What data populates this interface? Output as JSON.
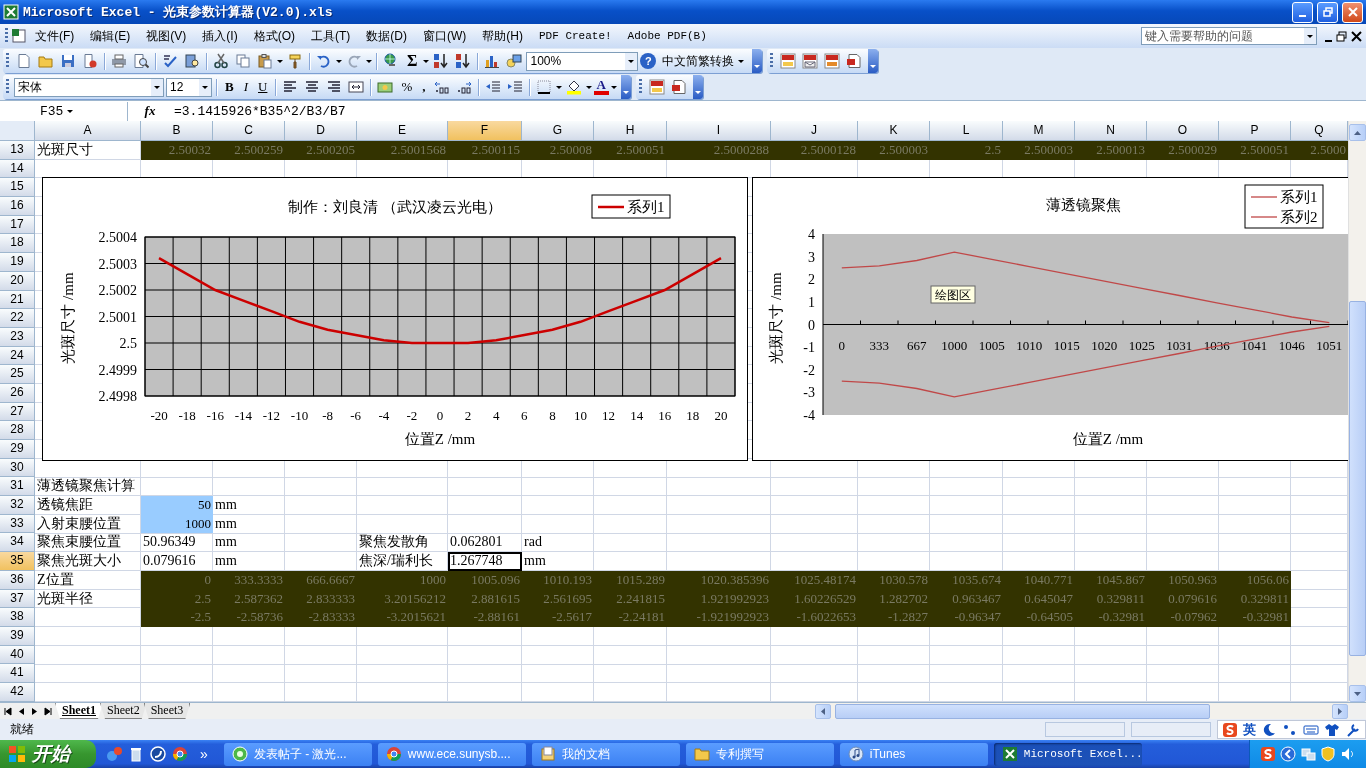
{
  "window": {
    "title": "Microsoft Excel - 光束参数计算器(V2.0).xls"
  },
  "menu": [
    {
      "label": "文件(F)"
    },
    {
      "label": "编辑(E)"
    },
    {
      "label": "视图(V)"
    },
    {
      "label": "插入(I)"
    },
    {
      "label": "格式(O)"
    },
    {
      "label": "工具(T)"
    },
    {
      "label": "数据(D)"
    },
    {
      "label": "窗口(W)"
    },
    {
      "label": "帮助(H)"
    },
    {
      "label": "PDF Create!"
    },
    {
      "label": "Adobe PDF(B)"
    }
  ],
  "help_box": {
    "placeholder": "键入需要帮助的问题"
  },
  "standard_toolbar": {
    "autosum": "Σ",
    "zoom": "100%",
    "help": "?",
    "convert": "中文简繁转换"
  },
  "formatting_toolbar": {
    "font": "宋体",
    "size": "12",
    "bold": "B",
    "italic": "I",
    "underline": "U",
    "percent": "%",
    "comma": ",",
    "font_color": "A"
  },
  "formula_bar": {
    "name_box": "F35",
    "fx": "fx",
    "formula": "=3.1415926*B35^2/B3/B7"
  },
  "sheet": {
    "columns": [
      {
        "label": "A",
        "selected": false
      },
      {
        "label": "B",
        "selected": false
      },
      {
        "label": "C",
        "selected": false
      },
      {
        "label": "D",
        "selected": false
      },
      {
        "label": "E",
        "selected": false
      },
      {
        "label": "F",
        "selected": true
      },
      {
        "label": "G",
        "selected": false
      },
      {
        "label": "H",
        "selected": false
      },
      {
        "label": "I",
        "selected": false
      },
      {
        "label": "J",
        "selected": false
      },
      {
        "label": "K",
        "selected": false
      },
      {
        "label": "L",
        "selected": false
      },
      {
        "label": "M",
        "selected": false
      },
      {
        "label": "N",
        "selected": false
      },
      {
        "label": "O",
        "selected": false
      },
      {
        "label": "P",
        "selected": false
      },
      {
        "label": "Q",
        "selected": false
      }
    ],
    "rows": [
      {
        "label": "13",
        "selected": false,
        "cells": [
          {
            "text": "光斑尺寸",
            "kind": "text"
          },
          {
            "text": "2.50032",
            "kind": "data"
          },
          {
            "text": "2.500259",
            "kind": "data"
          },
          {
            "text": "2.500205",
            "kind": "data"
          },
          {
            "text": "2.5001568",
            "kind": "data"
          },
          {
            "text": "2.500115",
            "kind": "data"
          },
          {
            "text": "2.50008",
            "kind": "data"
          },
          {
            "text": "2.500051",
            "kind": "data"
          },
          {
            "text": "2.5000288",
            "kind": "data"
          },
          {
            "text": "2.5000128",
            "kind": "data"
          },
          {
            "text": "2.500003",
            "kind": "data"
          },
          {
            "text": "2.5",
            "kind": "data"
          },
          {
            "text": "2.500003",
            "kind": "data"
          },
          {
            "text": "2.500013",
            "kind": "data"
          },
          {
            "text": "2.500029",
            "kind": "data"
          },
          {
            "text": "2.500051",
            "kind": "data"
          },
          {
            "text": "2.5000",
            "kind": "data"
          }
        ]
      },
      {
        "label": "14",
        "selected": false
      },
      {
        "label": "15",
        "selected": false
      },
      {
        "label": "16",
        "selected": false
      },
      {
        "label": "17",
        "selected": false
      },
      {
        "label": "18",
        "selected": false
      },
      {
        "label": "19",
        "selected": false
      },
      {
        "label": "20",
        "selected": false
      },
      {
        "label": "21",
        "selected": false
      },
      {
        "label": "22",
        "selected": false
      },
      {
        "label": "23",
        "selected": false
      },
      {
        "label": "24",
        "selected": false
      },
      {
        "label": "25",
        "selected": false
      },
      {
        "label": "26",
        "selected": false
      },
      {
        "label": "27",
        "selected": false
      },
      {
        "label": "28",
        "selected": false
      },
      {
        "label": "29",
        "selected": false
      },
      {
        "label": "30",
        "selected": false
      },
      {
        "label": "31",
        "selected": false,
        "cells": [
          {
            "text": "薄透镜聚焦计算",
            "kind": "text"
          }
        ]
      },
      {
        "label": "32",
        "selected": false,
        "cells": [
          {
            "text": "透镜焦距",
            "kind": "text"
          },
          {
            "text": "50",
            "kind": "input"
          },
          {
            "text": "mm",
            "kind": "text"
          }
        ]
      },
      {
        "label": "33",
        "selected": false,
        "cells": [
          {
            "text": "入射束腰位置",
            "kind": "text"
          },
          {
            "text": "1000",
            "kind": "input"
          },
          {
            "text": "mm",
            "kind": "text"
          }
        ]
      },
      {
        "label": "34",
        "selected": false,
        "cells": [
          {
            "text": "聚焦束腰位置",
            "kind": "text"
          },
          {
            "text": "50.96349",
            "kind": "text"
          },
          {
            "text": "mm",
            "kind": "text"
          },
          null,
          {
            "text": "聚焦发散角",
            "kind": "text"
          },
          {
            "text": "0.062801",
            "kind": "text"
          },
          {
            "text": "rad",
            "kind": "text"
          }
        ]
      },
      {
        "label": "35",
        "selected": true,
        "cells": [
          {
            "text": "聚焦光斑大小",
            "kind": "text"
          },
          {
            "text": "0.079616",
            "kind": "text"
          },
          {
            "text": "mm",
            "kind": "text"
          },
          null,
          {
            "text": "焦深/瑞利长",
            "kind": "text"
          },
          {
            "text": "1.267748",
            "kind": "text"
          },
          {
            "text": "mm",
            "kind": "text"
          }
        ]
      },
      {
        "label": "36",
        "selected": false,
        "cells": [
          {
            "text": "Z位置",
            "kind": "text"
          },
          {
            "text": "0",
            "kind": "data"
          },
          {
            "text": "333.3333",
            "kind": "data"
          },
          {
            "text": "666.6667",
            "kind": "data"
          },
          {
            "text": "1000",
            "kind": "data"
          },
          {
            "text": "1005.096",
            "kind": "data"
          },
          {
            "text": "1010.193",
            "kind": "data"
          },
          {
            "text": "1015.289",
            "kind": "data"
          },
          {
            "text": "1020.385396",
            "kind": "data"
          },
          {
            "text": "1025.48174",
            "kind": "data"
          },
          {
            "text": "1030.578",
            "kind": "data"
          },
          {
            "text": "1035.674",
            "kind": "data"
          },
          {
            "text": "1040.771",
            "kind": "data"
          },
          {
            "text": "1045.867",
            "kind": "data"
          },
          {
            "text": "1050.963",
            "kind": "data"
          },
          {
            "text": "1056.06",
            "kind": "data"
          }
        ]
      },
      {
        "label": "37",
        "selected": false,
        "cells": [
          {
            "text": "光斑半径",
            "kind": "text"
          },
          {
            "text": "2.5",
            "kind": "data"
          },
          {
            "text": "2.587362",
            "kind": "data"
          },
          {
            "text": "2.833333",
            "kind": "data"
          },
          {
            "text": "3.20156212",
            "kind": "data"
          },
          {
            "text": "2.881615",
            "kind": "data"
          },
          {
            "text": "2.561695",
            "kind": "data"
          },
          {
            "text": "2.241815",
            "kind": "data"
          },
          {
            "text": "1.921992923",
            "kind": "data"
          },
          {
            "text": "1.60226529",
            "kind": "data"
          },
          {
            "text": "1.282702",
            "kind": "data"
          },
          {
            "text": "0.963467",
            "kind": "data"
          },
          {
            "text": "0.645047",
            "kind": "data"
          },
          {
            "text": "0.329811",
            "kind": "data"
          },
          {
            "text": "0.079616",
            "kind": "data"
          },
          {
            "text": "0.329811",
            "kind": "data"
          }
        ]
      },
      {
        "label": "38",
        "selected": false,
        "cells": [
          null,
          {
            "text": "-2.5",
            "kind": "data"
          },
          {
            "text": "-2.58736",
            "kind": "data"
          },
          {
            "text": "-2.83333",
            "kind": "data"
          },
          {
            "text": "-3.2015621",
            "kind": "data"
          },
          {
            "text": "-2.88161",
            "kind": "data"
          },
          {
            "text": "-2.5617",
            "kind": "data"
          },
          {
            "text": "-2.24181",
            "kind": "data"
          },
          {
            "text": "-1.921992923",
            "kind": "data"
          },
          {
            "text": "-1.6022653",
            "kind": "data"
          },
          {
            "text": "-1.2827",
            "kind": "data"
          },
          {
            "text": "-0.96347",
            "kind": "data"
          },
          {
            "text": "-0.64505",
            "kind": "data"
          },
          {
            "text": "-0.32981",
            "kind": "data"
          },
          {
            "text": "-0.07962",
            "kind": "data"
          },
          {
            "text": "-0.32981",
            "kind": "data"
          }
        ]
      },
      {
        "label": "39",
        "selected": false
      },
      {
        "label": "40",
        "selected": false
      },
      {
        "label": "41",
        "selected": false
      },
      {
        "label": "42",
        "selected": false
      }
    ],
    "charts": [
      {
        "chart_data": {
          "type": "line",
          "title": "制作：刘良清  （武汉凌云光电）",
          "xlabel": "位置Z /mm",
          "ylabel": "光斑尺寸 /mm",
          "grid": true,
          "legend": true,
          "categories": [
            "-20",
            "-18",
            "-16",
            "-14",
            "-12",
            "-10",
            "-8",
            "-6",
            "-4",
            "-2",
            "0",
            "2",
            "4",
            "6",
            "8",
            "10",
            "12",
            "14",
            "16",
            "18",
            "20"
          ],
          "ylim": [
            2.4998,
            2.5004
          ],
          "yticks": [
            2.4998,
            2.4999,
            2.5,
            2.5001,
            2.5002,
            2.5003,
            2.5004
          ],
          "series": [
            {
              "name": "系列1",
              "color": "#cc0000",
              "values": [
                2.50032,
                2.50026,
                2.5002,
                2.50016,
                2.50012,
                2.50008,
                2.50005,
                2.50003,
                2.50001,
                2.5,
                2.5,
                2.5,
                2.50001,
                2.50003,
                2.50005,
                2.50008,
                2.50012,
                2.50016,
                2.5002,
                2.50026,
                2.50032
              ]
            }
          ]
        }
      },
      {
        "chart_data": {
          "type": "line",
          "title": "薄透镜聚焦",
          "xlabel": "位置Z   /mm",
          "ylabel": "光斑尺寸  /mm",
          "legend": true,
          "categories": [
            "0",
            "333",
            "667",
            "1000",
            "1005",
            "1010",
            "1015",
            "1020",
            "1025",
            "1031",
            "1036",
            "1041",
            "1046",
            "1051"
          ],
          "ylim": [
            -4,
            4
          ],
          "yticks": [
            -4,
            -3,
            -2,
            -1,
            0,
            1,
            2,
            3,
            4
          ],
          "series": [
            {
              "name": "系列1",
              "color": "#c04848",
              "values": [
                2.5,
                2.59,
                2.83,
                3.2,
                2.88,
                2.56,
                2.24,
                1.92,
                1.6,
                1.28,
                0.96,
                0.65,
                0.33,
                0.08
              ]
            },
            {
              "name": "系列2",
              "color": "#c04848",
              "values": [
                -2.5,
                -2.59,
                -2.83,
                -3.2,
                -2.88,
                -2.56,
                -2.24,
                -1.92,
                -1.6,
                -1.28,
                -0.96,
                -0.65,
                -0.33,
                -0.08
              ]
            }
          ]
        },
        "tooltip": "绘图区"
      }
    ]
  },
  "sheet_tabs": [
    {
      "label": "Sheet1",
      "selected": true
    },
    {
      "label": "Sheet2",
      "selected": false
    },
    {
      "label": "Sheet3",
      "selected": false
    }
  ],
  "status_bar": {
    "text": "就绪",
    "ime": "英"
  },
  "taskbar": {
    "start": "开始",
    "more": "»",
    "tasks": [
      {
        "label": "发表帖子 - 激光...",
        "kind": "page",
        "selected": false
      },
      {
        "label": "www.ece.sunysb....",
        "kind": "browser",
        "selected": false
      },
      {
        "label": "我的文档",
        "kind": "documents",
        "selected": false
      },
      {
        "label": "专利撰写",
        "kind": "folder",
        "selected": false
      },
      {
        "label": "iTunes",
        "kind": "music",
        "selected": false
      },
      {
        "label": "Microsoft Excel...",
        "kind": "excel",
        "selected": true
      }
    ]
  }
}
